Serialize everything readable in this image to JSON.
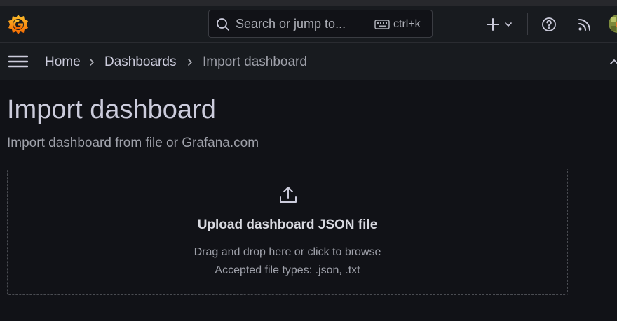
{
  "search": {
    "placeholder": "Search or jump to...",
    "shortcut": "ctrl+k"
  },
  "breadcrumb": {
    "items": [
      "Home",
      "Dashboards",
      "Import dashboard"
    ]
  },
  "page": {
    "title": "Import dashboard",
    "subtitle": "Import dashboard from file or Grafana.com"
  },
  "upload": {
    "title": "Upload dashboard JSON file",
    "hint": "Drag and drop here or click to browse",
    "accepted": "Accepted file types: .json, .txt"
  },
  "icons": {
    "logo": "grafana-logo",
    "search": "search-icon",
    "keyboard": "keyboard-icon",
    "add": "plus-icon",
    "help": "help-icon",
    "news": "rss-icon",
    "menu": "hamburger-icon",
    "upload": "upload-icon"
  },
  "colors": {
    "background": "#111217",
    "panel": "#181b1f",
    "text": "#ccccdc",
    "muted": "#9fa1aa",
    "brand_orange": "#f46800",
    "brand_yellow": "#fbc02d"
  }
}
